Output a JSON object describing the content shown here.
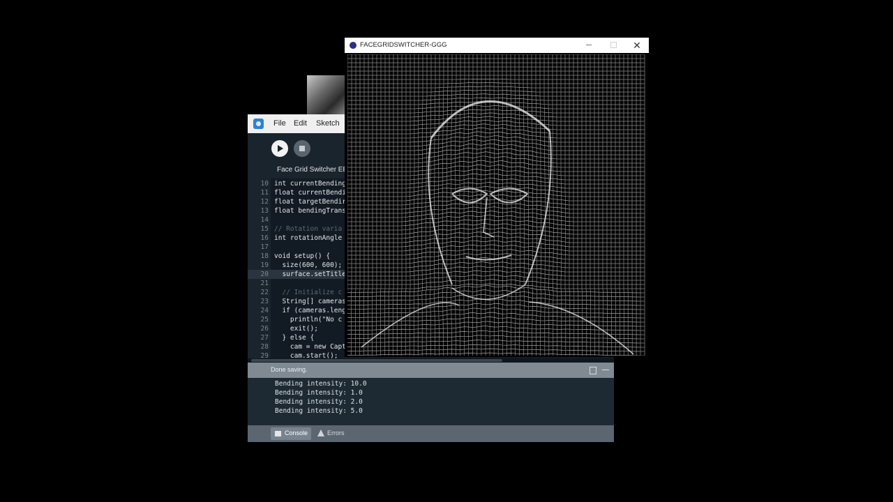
{
  "ide": {
    "menu": [
      "File",
      "Edit",
      "Sketch"
    ],
    "tab_title": "Face Grid Switcher EE",
    "lines": [
      {
        "n": "10",
        "text": "int currentBending",
        "style": "plain"
      },
      {
        "n": "11",
        "text": "float currentBendi",
        "style": "plain"
      },
      {
        "n": "12",
        "text": "float targetBendir",
        "style": "plain"
      },
      {
        "n": "13",
        "text": "float bendingTrans",
        "style": "plain"
      },
      {
        "n": "14",
        "text": "",
        "style": "plain"
      },
      {
        "n": "15",
        "text": "// Rotation varia",
        "style": "comment"
      },
      {
        "n": "16",
        "text": "int rotationAngle",
        "style": "plain"
      },
      {
        "n": "17",
        "text": "",
        "style": "plain"
      },
      {
        "n": "18",
        "text": "void setup() {",
        "style": "plain"
      },
      {
        "n": "19",
        "text": "  size(600, 600);",
        "style": "plain"
      },
      {
        "n": "20",
        "text": "  surface.setTitle",
        "style": "plain"
      },
      {
        "n": "21",
        "text": "",
        "style": "plain"
      },
      {
        "n": "22",
        "text": "  // Initialize c",
        "style": "comment"
      },
      {
        "n": "23",
        "text": "  String[] cameras",
        "style": "plain"
      },
      {
        "n": "24",
        "text": "  if (cameras.leng",
        "style": "plain"
      },
      {
        "n": "25",
        "text": "    println(\"No c",
        "style": "plain"
      },
      {
        "n": "26",
        "text": "    exit();",
        "style": "plain"
      },
      {
        "n": "27",
        "text": "  } else {",
        "style": "plain"
      },
      {
        "n": "28",
        "text": "    cam = new Capt",
        "style": "plain"
      },
      {
        "n": "29",
        "text": "    cam.start();",
        "style": "plain"
      }
    ],
    "current_line": "20",
    "status": "Done saving.",
    "console_lines": [
      "Bending intensity: 10.0",
      "Bending intensity: 1.0",
      "Bending intensity: 2.0",
      "Bending intensity: 5.0"
    ],
    "tabs": {
      "console": "Console",
      "errors": "Errors"
    },
    "colors": {
      "background": "#1a242d",
      "keyword": "#e2336b",
      "comment": "#5a6a78"
    }
  },
  "sketch": {
    "title": "FACEGRIDSWITCHER-GGG",
    "close_glyph": "✕",
    "image_description_icon": "face-grid-mesh"
  }
}
